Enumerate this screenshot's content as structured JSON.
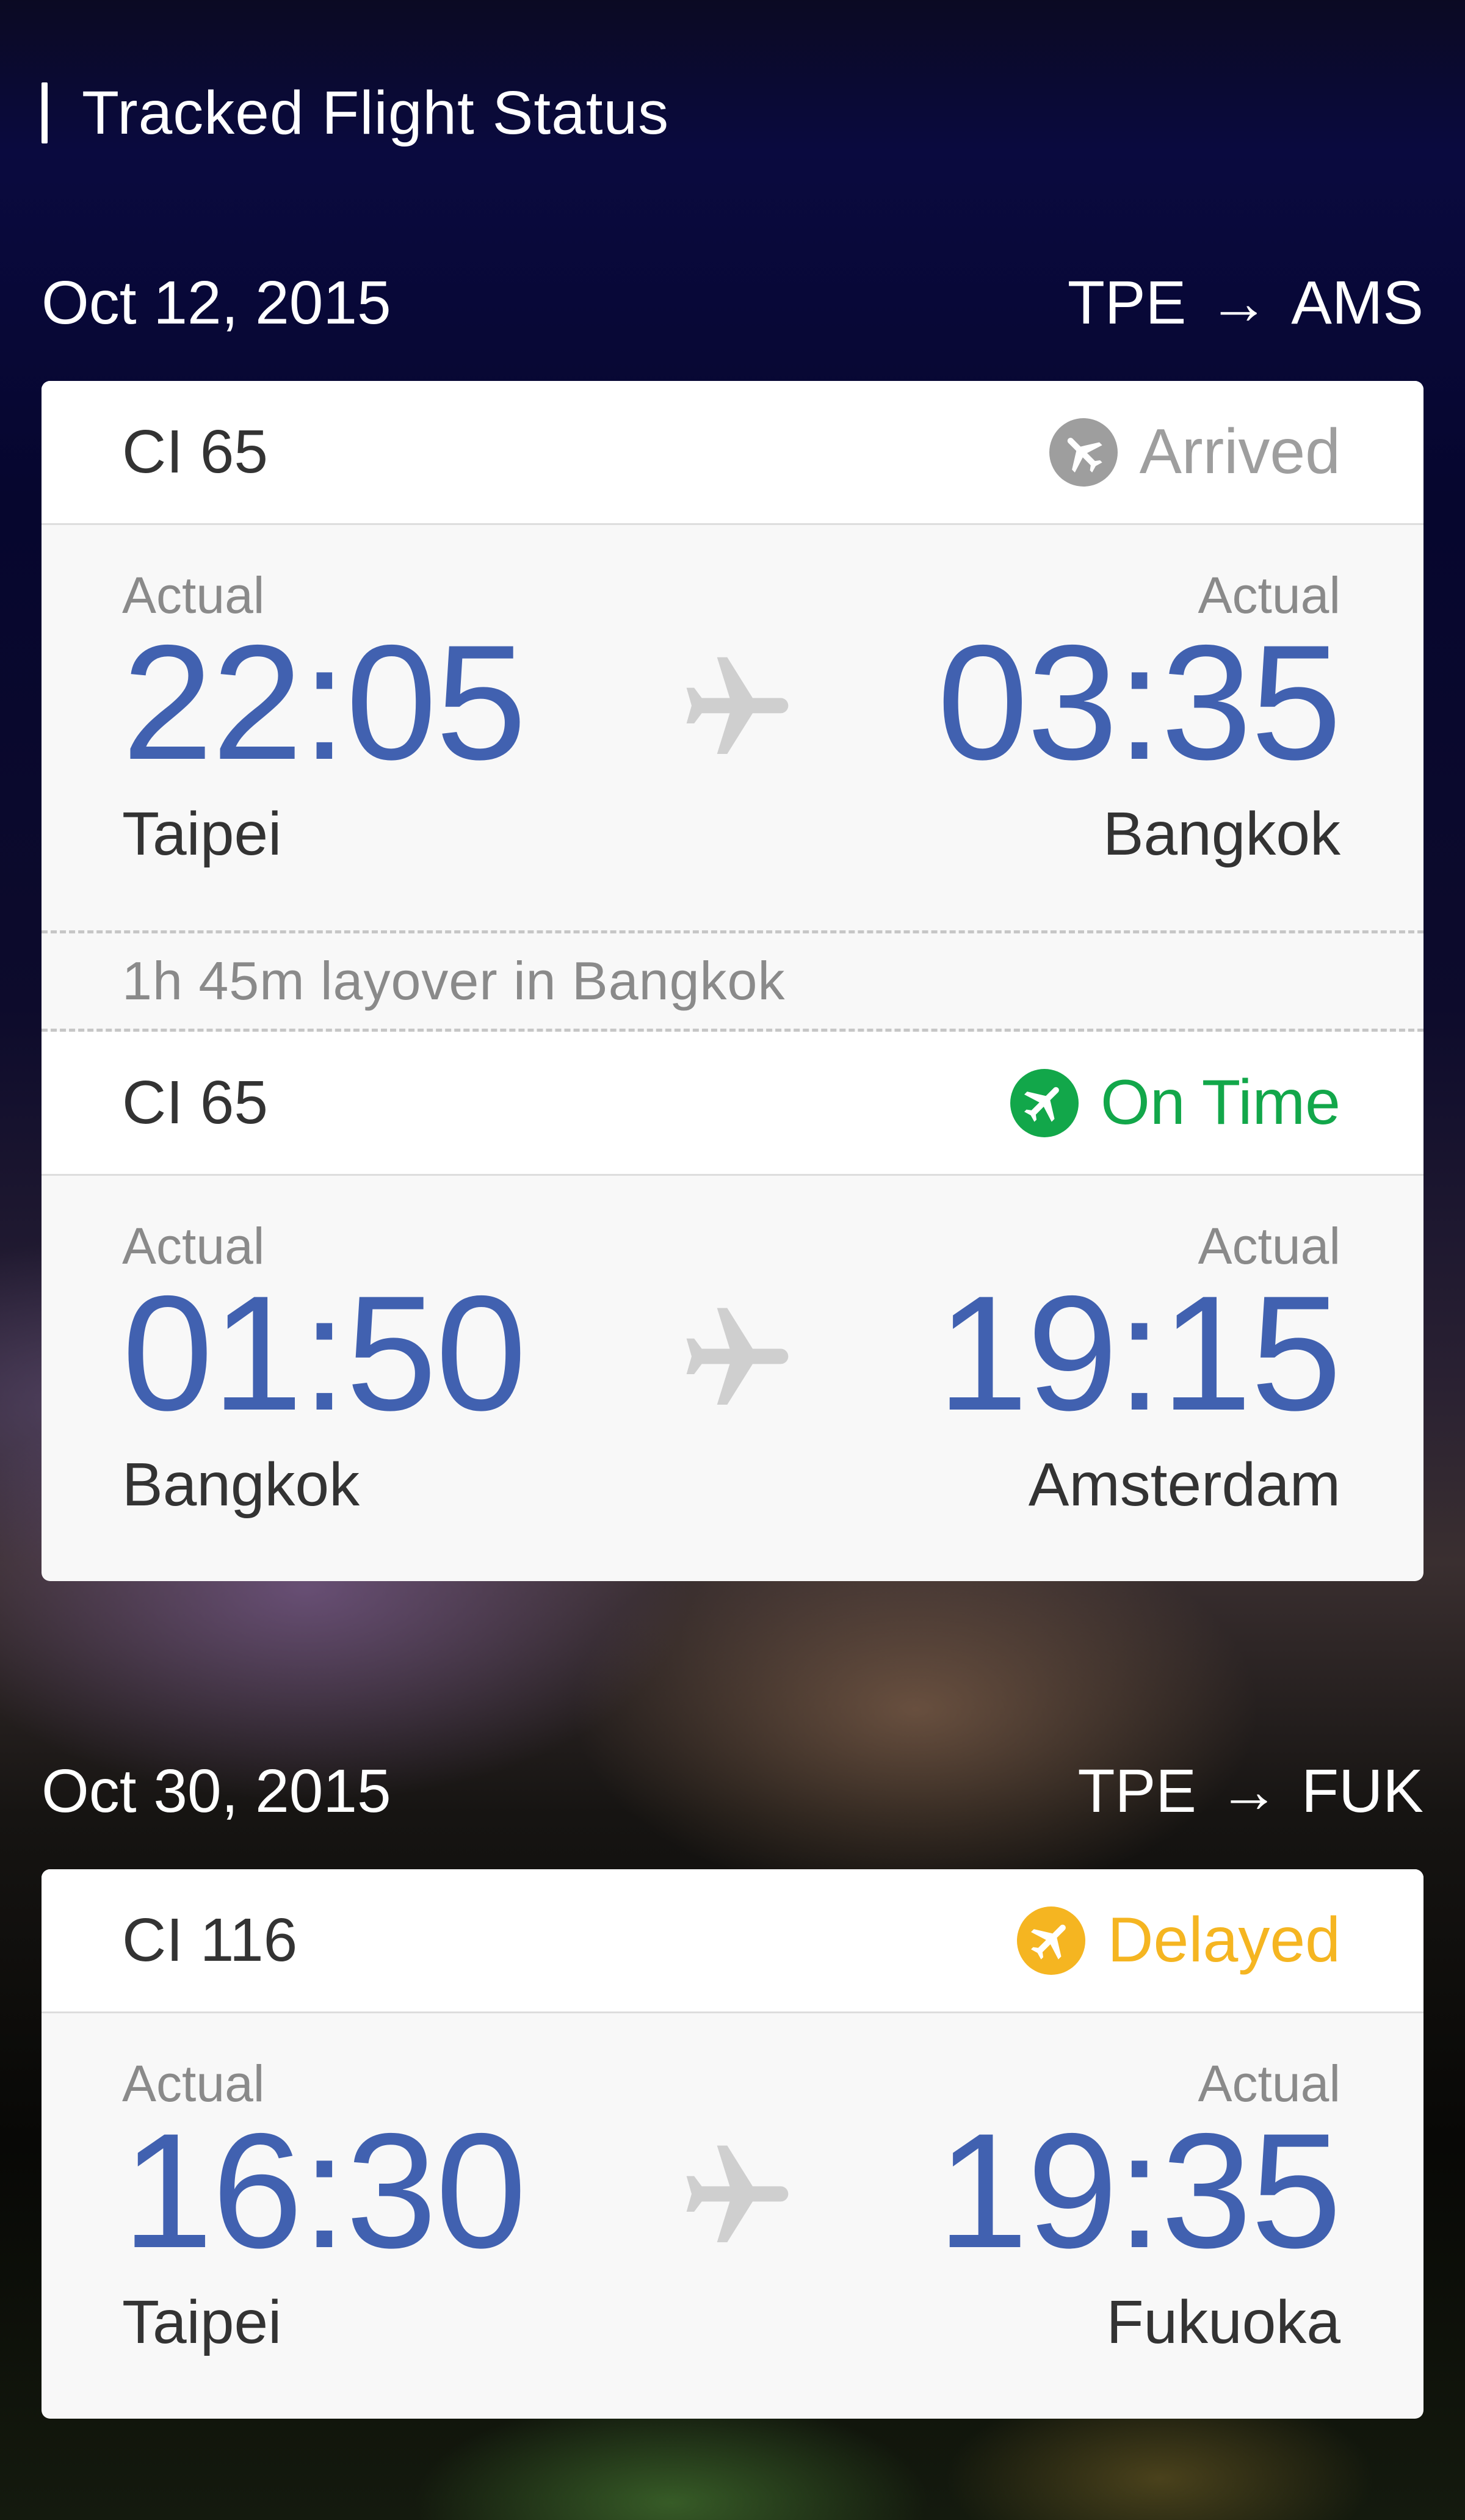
{
  "header": {
    "title": "Tracked Flight Status"
  },
  "trips": [
    {
      "date": "Oct 12, 2015",
      "origin": "TPE",
      "arrow": "→",
      "destination": "AMS",
      "segments": [
        {
          "flight": "CI 65",
          "status": "Arrived",
          "status_icon": "plane-circle-icon",
          "departure": {
            "label": "Actual",
            "time": "22:05",
            "city": "Taipei"
          },
          "arrival": {
            "label": "Actual",
            "time": "03:35",
            "city": "Bangkok"
          }
        },
        {
          "flight": "CI 65",
          "status": "On Time",
          "status_icon": "plane-circle-icon",
          "departure": {
            "label": "Actual",
            "time": "01:50",
            "city": "Bangkok"
          },
          "arrival": {
            "label": "Actual",
            "time": "19:15",
            "city": "Amsterdam"
          }
        }
      ],
      "layover": "1h 45m layover in Bangkok"
    },
    {
      "date": "Oct 30, 2015",
      "origin": "TPE",
      "arrow": "→",
      "destination": "FUK",
      "segments": [
        {
          "flight": "CI 116",
          "status": "Delayed",
          "status_icon": "plane-circle-icon",
          "departure": {
            "label": "Actual",
            "time": "16:30",
            "city": "Taipei"
          },
          "arrival": {
            "label": "Actual",
            "time": "19:35",
            "city": "Fukuoka"
          }
        }
      ]
    }
  ],
  "colors": {
    "time_blue": "#4161b0",
    "arrived_gray": "#9e9e9e",
    "on_time_green": "#12a74a",
    "delayed_yellow": "#f5b521",
    "plane_gray": "#cfcfcf"
  }
}
